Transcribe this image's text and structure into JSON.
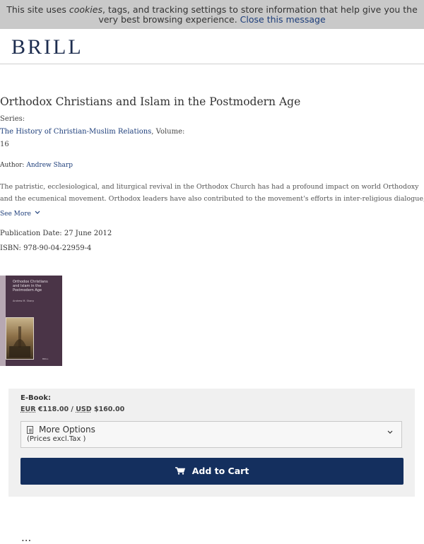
{
  "cookie_banner": {
    "text_before": "This site uses ",
    "cookies_word": "cookies",
    "text_after": ", tags, and tracking settings to store information that help give you the very best browsing experience. ",
    "close_link": "Close this message"
  },
  "header": {
    "logo": "BRILL"
  },
  "book": {
    "title": "Orthodox Christians and Islam in the Postmodern Age",
    "series_label": "Series:",
    "series_name": "The History of Christian-Muslim Relations",
    "volume_label": ", Volume:",
    "volume_number": "16",
    "author_label": "Author: ",
    "author_name": "Andrew Sharp",
    "description_line1": "The patristic, ecclesiological, and liturgical revival in the Orthodox Church has had a profound impact on world Orthodoxy",
    "description_line2": "and the ecumenical movement. Orthodox leaders have also contributed to the movement's efforts in inter-religious dialogue,",
    "see_more": "See More",
    "publication_date": "Publication Date: 27 June 2012",
    "isbn": "ISBN: 978-90-04-22959-4"
  },
  "cover": {
    "title_line1": "Orthodox Christians",
    "title_line2": "and Islam in the",
    "title_line3": "Postmodern Age",
    "author": "Andrew M. Sharp",
    "publisher": "BRILL"
  },
  "purchase": {
    "format_label": "E-Book:",
    "eur_code": "EUR",
    "eur_price": " €118.00",
    "separator": " / ",
    "usd_code": "USD",
    "usd_price": " $160.00",
    "options_label": "More Options",
    "options_sub": "(Prices excl.Tax )",
    "add_to_cart": "Add to Cart"
  },
  "bottom_text": "..."
}
